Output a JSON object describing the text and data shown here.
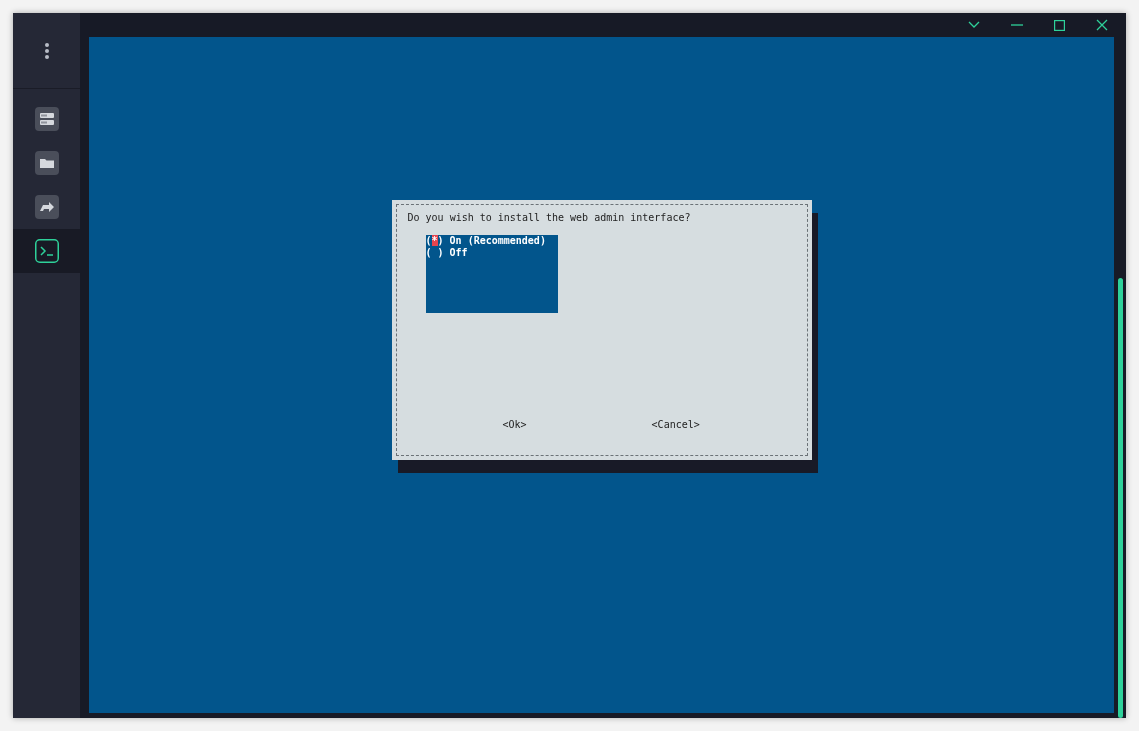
{
  "sidebar": {
    "items": [
      {
        "kind": "servers",
        "selected": false
      },
      {
        "kind": "files",
        "selected": false
      },
      {
        "kind": "forward",
        "selected": false
      },
      {
        "kind": "terminal",
        "selected": true
      }
    ]
  },
  "dialog": {
    "question": "Do you wish to install the web admin interface?",
    "options": [
      {
        "radio": "(*)",
        "label": "On (Recommended)",
        "selected": true
      },
      {
        "radio": "( )",
        "label": "Off",
        "selected": false
      }
    ],
    "buttons": [
      "<Ok>",
      "<Cancel>"
    ]
  }
}
